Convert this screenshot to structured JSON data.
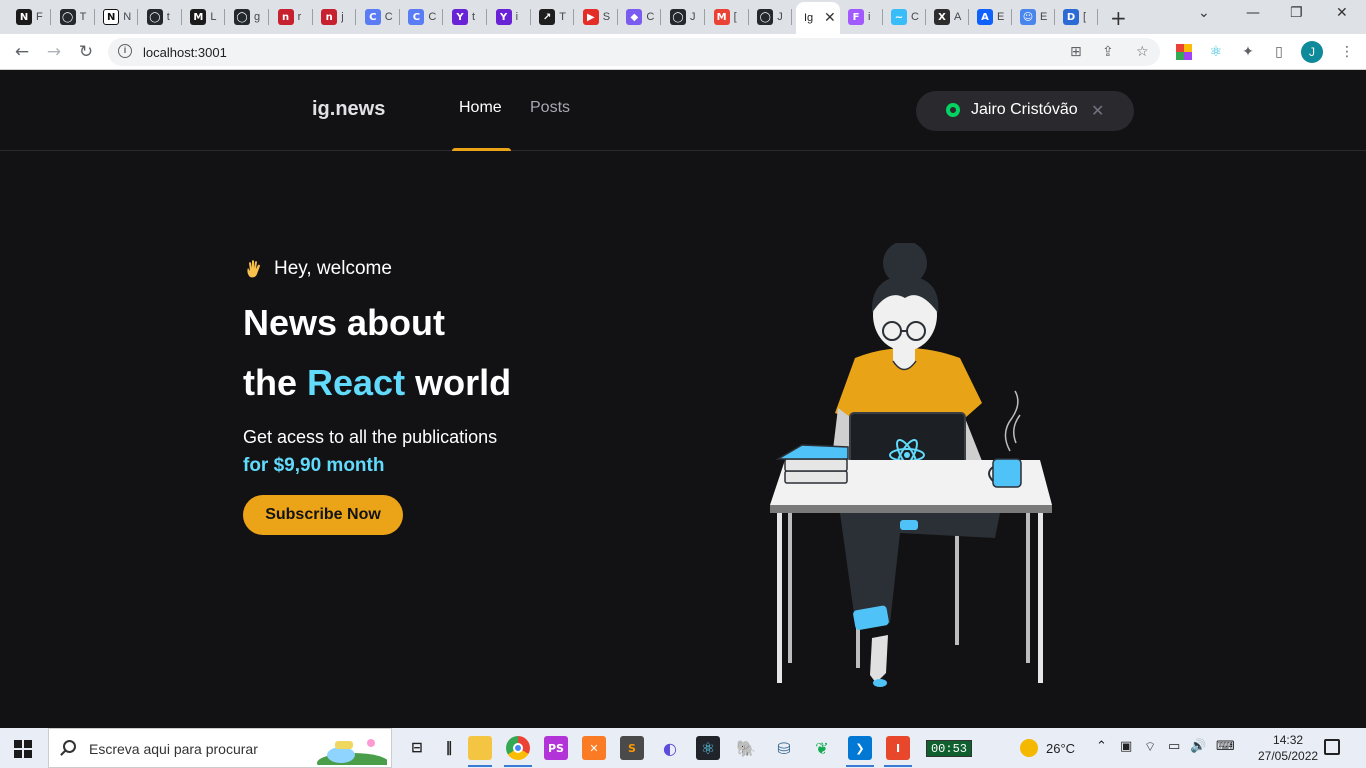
{
  "browser": {
    "tabs": [
      {
        "letter": "N",
        "text": "F",
        "color": "#1a1a1a"
      },
      {
        "letter": "◯",
        "text": "T",
        "color": "#24292e"
      },
      {
        "letter": "N",
        "text": "N",
        "color": "#ffffff"
      },
      {
        "letter": "◯",
        "text": "t",
        "color": "#24292e"
      },
      {
        "letter": "M",
        "text": "L",
        "color": "#1a1a1a"
      },
      {
        "letter": "◯",
        "text": "g",
        "color": "#24292e"
      },
      {
        "letter": "n",
        "text": "r",
        "color": "#c7202f"
      },
      {
        "letter": "n",
        "text": "j",
        "color": "#c7202f"
      },
      {
        "letter": "C",
        "text": "C",
        "color": "#5a7df5"
      },
      {
        "letter": "C",
        "text": "C",
        "color": "#5a7df5"
      },
      {
        "letter": "Y",
        "text": "t",
        "color": "#6a22d6"
      },
      {
        "letter": "Y",
        "text": "i",
        "color": "#6a22d6"
      },
      {
        "letter": "↗",
        "text": "T",
        "color": "#1e1e1e"
      },
      {
        "letter": "▶",
        "text": "S",
        "color": "#e52d27"
      },
      {
        "letter": "◆",
        "text": "C",
        "color": "#7b5cf0"
      },
      {
        "letter": "◯",
        "text": "J",
        "color": "#24292e"
      },
      {
        "letter": "M",
        "text": "[",
        "color": "#ea4335"
      },
      {
        "letter": "◯",
        "text": "J",
        "color": "#24292e"
      }
    ],
    "active_tab": {
      "text": "Ig"
    },
    "tabs_after": [
      {
        "letter": "F",
        "text": "i",
        "color": "#a259ff"
      },
      {
        "letter": "~",
        "text": "C",
        "color": "#38bdf8"
      },
      {
        "letter": "X",
        "text": "A",
        "color": "#2d2d2d"
      },
      {
        "letter": "A",
        "text": "E",
        "color": "#0f62fe"
      },
      {
        "letter": "☺",
        "text": "E",
        "color": "#4885ed"
      },
      {
        "letter": "D",
        "text": "[",
        "color": "#2b6cd4"
      }
    ],
    "new_tab": "+",
    "url": "localhost:3001",
    "profile_initial": "J"
  },
  "app": {
    "logo": "ig.news",
    "nav": {
      "home": "Home",
      "posts": "Posts"
    },
    "signin": {
      "user": "Jairo Cristóvão"
    },
    "hero": {
      "welcome": "Hey, welcome",
      "title_line1": "News about",
      "title_line2_pre": "the",
      "title_line2_accent": "React",
      "title_line2_post": "world",
      "subtitle": "Get acess to all the publications",
      "price": "for $9,90 month",
      "cta": "Subscribe Now"
    },
    "colors": {
      "accent_cyan": "#61dafb",
      "accent_yellow": "#eba417",
      "bg": "#121214"
    }
  },
  "taskbar": {
    "search_placeholder": "Escreva aqui para procurar",
    "timer": "00:53",
    "temperature": "26°C",
    "time": "14:32",
    "date": "27/05/2022"
  }
}
